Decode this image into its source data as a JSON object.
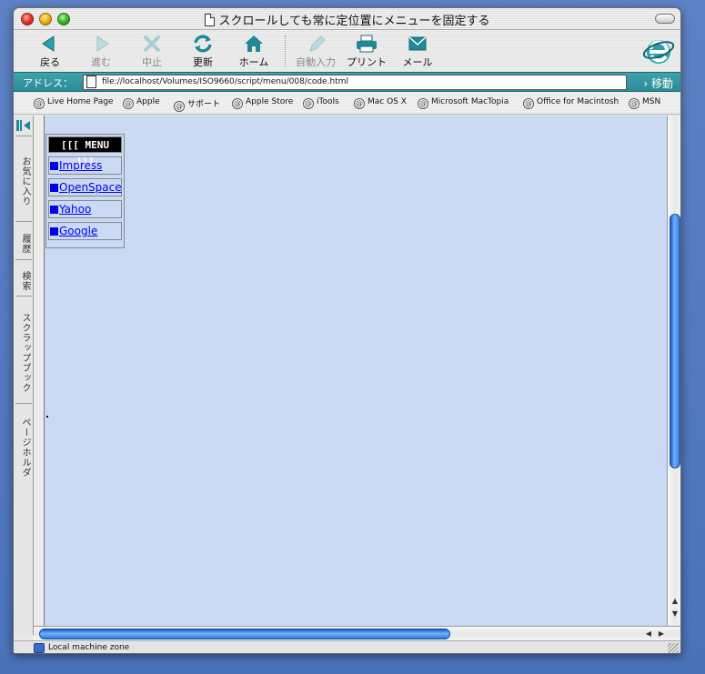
{
  "window": {
    "title": "スクロールしても常に定位置にメニューを固定する"
  },
  "toolbar": {
    "back": "戻る",
    "forward": "進む",
    "stop": "中止",
    "refresh": "更新",
    "home": "ホーム",
    "autofill": "自動入力",
    "print": "プリント",
    "mail": "メール"
  },
  "address": {
    "label": "アドレス：",
    "url": "file://localhost/Volumes/ISO9660/script/menu/008/code.html",
    "go": "移動"
  },
  "favorites": [
    "Live Home Page",
    "Apple",
    "サポート",
    "Apple Store",
    "iTools",
    "Mac OS X",
    "Microsoft MacTopia",
    "Office for Macintosh",
    "MSN"
  ],
  "explorer_tabs": [
    "お気に入り",
    "履歴",
    "検索",
    "スクラップブック",
    "ページホルダ"
  ],
  "menu": {
    "title": "[[[ MENU ]]]",
    "items": [
      "Impress",
      "OpenSpace",
      "Yahoo",
      "Google"
    ]
  },
  "status": {
    "zone": "Local machine zone"
  },
  "colors": {
    "content_background": "#cad9f4",
    "link": "#0000ee",
    "address_bar": "#2b8a95",
    "scroll_thumb": "#2f7ad8"
  },
  "icons": {
    "back": "left-arrow-icon",
    "forward": "right-arrow-icon",
    "stop": "x-icon",
    "refresh": "refresh-icon",
    "home": "house-icon",
    "autofill": "pen-icon",
    "print": "printer-icon",
    "mail": "envelope-icon",
    "logo": "ie-logo-icon"
  }
}
